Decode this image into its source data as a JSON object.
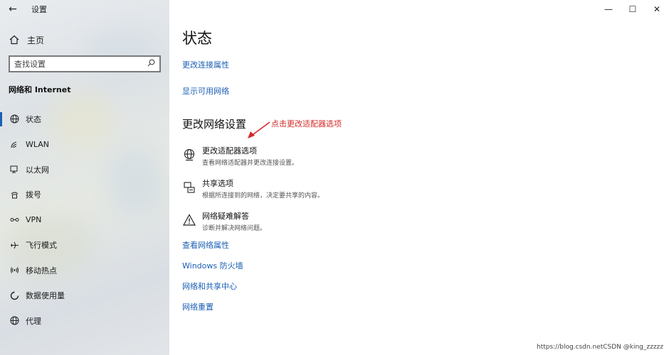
{
  "window": {
    "back_icon": "back-arrow-icon",
    "title": "设置",
    "controls": [
      "minimize",
      "maximize",
      "close"
    ]
  },
  "sidebar": {
    "home_label": "主页",
    "search_placeholder": "查找设置",
    "section_title": "网络和 Internet",
    "items": [
      {
        "label": "状态",
        "icon": "globe-icon",
        "active": true
      },
      {
        "label": "WLAN",
        "icon": "wifi-icon",
        "active": false
      },
      {
        "label": "以太网",
        "icon": "ethernet-icon",
        "active": false
      },
      {
        "label": "拨号",
        "icon": "dialup-icon",
        "active": false
      },
      {
        "label": "VPN",
        "icon": "vpn-icon",
        "active": false
      },
      {
        "label": "飞行模式",
        "icon": "airplane-icon",
        "active": false
      },
      {
        "label": "移动热点",
        "icon": "hotspot-icon",
        "active": false
      },
      {
        "label": "数据使用量",
        "icon": "data-usage-icon",
        "active": false
      },
      {
        "label": "代理",
        "icon": "proxy-globe-icon",
        "active": false
      }
    ]
  },
  "main": {
    "page_title": "状态",
    "links_top": [
      "更改连接属性",
      "显示可用网络"
    ],
    "sub_heading": "更改网络设置",
    "annotation": "点击更改适配器选项",
    "options": [
      {
        "title": "更改适配器选项",
        "desc": "查看网络适配器并更改连接设置。",
        "icon": "adapter-globe-icon"
      },
      {
        "title": "共享选项",
        "desc": "根据所连接到的网络，决定要共享的内容。",
        "icon": "sharing-icon"
      },
      {
        "title": "网络疑难解答",
        "desc": "诊断并解决网络问题。",
        "icon": "warning-icon"
      }
    ],
    "links_bottom": [
      "查看网络属性",
      "Windows 防火墙",
      "网络和共享中心",
      "网络重置"
    ]
  },
  "watermark": "https://blog.csdn.netCSDN @king_zzzzz",
  "colors": {
    "accent": "#1a5fb4",
    "annotation": "#d42a2a"
  }
}
